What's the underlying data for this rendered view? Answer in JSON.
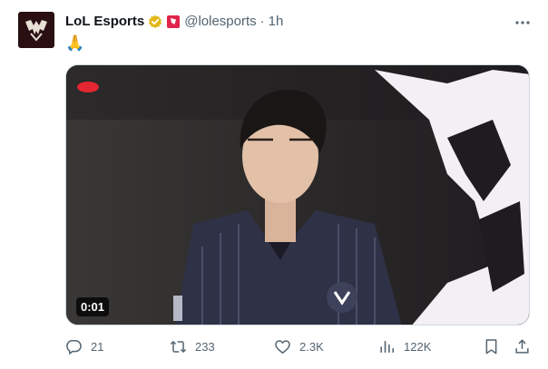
{
  "tweet": {
    "author_name": "LoL Esports",
    "handle": "@lolesports",
    "separator": "·",
    "time": "1h",
    "text": "🙏",
    "video_duration": "0:01"
  },
  "icons": {
    "avatar": "lol-worlds-logo",
    "verified": "gold-verified-badge",
    "affiliate": "red-affiliate-badge",
    "more": "more-horizontal-icon",
    "reply": "reply-icon",
    "retweet": "retweet-icon",
    "like": "heart-icon",
    "views": "views-icon",
    "bookmark": "bookmark-icon",
    "share": "share-icon"
  },
  "actions": {
    "replies": "21",
    "retweets": "233",
    "likes": "2.3K",
    "views": "122K"
  },
  "colors": {
    "text": "#0f1419",
    "secondary": "#536471",
    "verified_gold": "#e2b719",
    "affiliate_red": "#e0244b",
    "avatar_bg": "#2a0f12"
  }
}
